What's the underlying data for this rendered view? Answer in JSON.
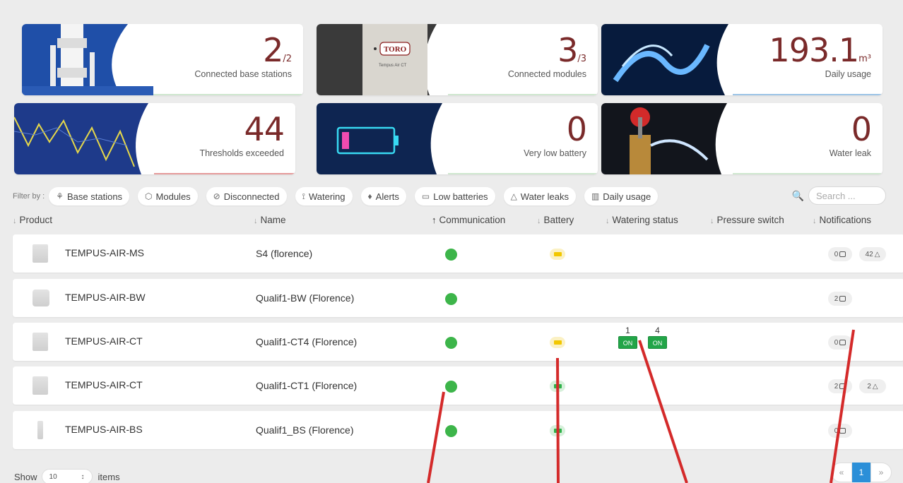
{
  "cards": [
    {
      "value": "2",
      "sub": "/2",
      "caption": "Connected base stations",
      "accent": "#cfe7cf"
    },
    {
      "value": "3",
      "sub": "/3",
      "caption": "Connected modules",
      "accent": "#cfe7cf",
      "device_brand": "TORO",
      "device_model": "Tempus Air CT"
    },
    {
      "value": "193.1",
      "sub": "m³",
      "caption": "Daily usage",
      "accent": "#9bc3e6"
    },
    {
      "value": "44",
      "sub": "",
      "caption": "Thresholds exceeded",
      "accent": "#e59a9a"
    },
    {
      "value": "0",
      "sub": "",
      "caption": "Very low battery",
      "accent": "#cfe7cf"
    },
    {
      "value": "0",
      "sub": "",
      "caption": "Water leak",
      "accent": "#cfe7cf"
    }
  ],
  "filter": {
    "label": "Filter by :",
    "chips": [
      {
        "label": "Base stations",
        "icon": "base-station-icon",
        "glyph": "⚘"
      },
      {
        "label": "Modules",
        "icon": "cube-icon",
        "glyph": "⬡"
      },
      {
        "label": "Disconnected",
        "icon": "disconnected-icon",
        "glyph": "⊘"
      },
      {
        "label": "Watering",
        "icon": "watering-icon",
        "glyph": "⟟"
      },
      {
        "label": "Alerts",
        "icon": "bell-icon",
        "glyph": "♫"
      },
      {
        "label": "Low batteries",
        "icon": "battery-icon",
        "glyph": "▭"
      },
      {
        "label": "Water leaks",
        "icon": "drop-icon",
        "glyph": "△"
      },
      {
        "label": "Daily usage",
        "icon": "chart-icon",
        "glyph": "▥"
      }
    ],
    "search_placeholder": "Search ..."
  },
  "columns": {
    "product": "Product",
    "name": "Name",
    "communication": "Communication",
    "battery": "Battery",
    "watering": "Watering status",
    "pressure": "Pressure switch",
    "notifications": "Notifications"
  },
  "rows": [
    {
      "product": "TEMPUS-AIR-MS",
      "name": "S4 (florence)",
      "comm": true,
      "battery": "yellow",
      "watering": [],
      "notifs": [
        {
          "text": "0",
          "kind": "box"
        },
        {
          "text": "42",
          "kind": "bell"
        }
      ]
    },
    {
      "product": "TEMPUS-AIR-BW",
      "name": "Qualif1-BW (Florence)",
      "comm": true,
      "battery": "",
      "watering": [],
      "notifs": [
        {
          "text": "2",
          "kind": "box"
        }
      ]
    },
    {
      "product": "TEMPUS-AIR-CT",
      "name": "Qualif1-CT4 (Florence)",
      "comm": true,
      "battery": "yellow",
      "watering": [
        {
          "num": "1",
          "label": "ON"
        },
        {
          "num": "4",
          "label": "ON"
        }
      ],
      "notifs": [
        {
          "text": "0",
          "kind": "box"
        }
      ]
    },
    {
      "product": "TEMPUS-AIR-CT",
      "name": "Qualif1-CT1 (Florence)",
      "comm": true,
      "battery": "green",
      "watering": [],
      "notifs": [
        {
          "text": "2",
          "kind": "box"
        },
        {
          "text": "2",
          "kind": "bell"
        }
      ]
    },
    {
      "product": "TEMPUS-AIR-BS",
      "name": "Qualif1_BS (Florence)",
      "comm": true,
      "battery": "green",
      "watering": [],
      "notifs": [
        {
          "text": "0",
          "kind": "box"
        }
      ]
    }
  ],
  "footer": {
    "show": "Show",
    "page_size": "10",
    "items": "items"
  },
  "pager": {
    "prev": "«",
    "current": "1",
    "next": "»"
  },
  "colors": {
    "value_text": "#7a2a2a",
    "status_ok": "#3db54a",
    "page_active": "#2b8fd8",
    "annotation": "#d42a2a"
  }
}
